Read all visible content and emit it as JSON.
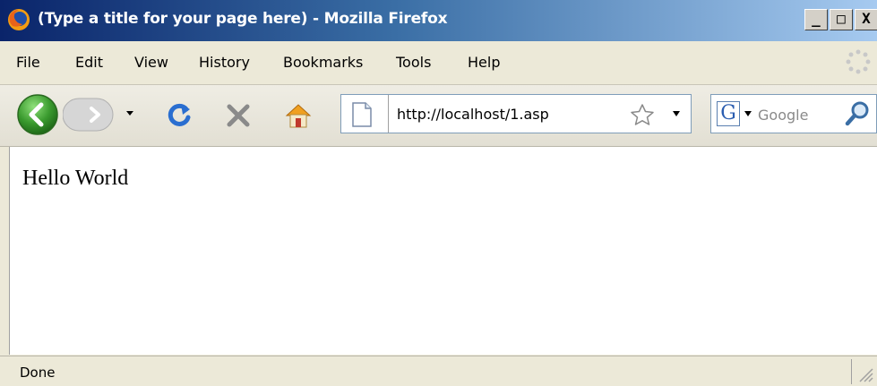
{
  "window": {
    "title": "(Type a title for your page here) - Mozilla Firefox",
    "controls": {
      "minimize": "_",
      "maximize": "□",
      "close": "X"
    }
  },
  "menu": {
    "items": [
      {
        "label": "File"
      },
      {
        "label": "Edit"
      },
      {
        "label": "View"
      },
      {
        "label": "History"
      },
      {
        "label": "Bookmarks"
      },
      {
        "label": "Tools"
      },
      {
        "label": "Help"
      }
    ]
  },
  "toolbar": {
    "icons": [
      "back-arrow-icon",
      "forward-arrow-icon",
      "reload-icon",
      "stop-icon",
      "home-icon"
    ]
  },
  "urlbar": {
    "value": "http://localhost/1.asp"
  },
  "search": {
    "engine_letter": "G",
    "placeholder": "Google"
  },
  "content": {
    "text": "Hello World"
  },
  "status": {
    "text": "Done"
  },
  "colors": {
    "titlebar_start": "#0a246a",
    "titlebar_end": "#a6caf0",
    "chrome": "#ece9d8",
    "back_button": "#3a9a2e",
    "reload": "#2a6ed0",
    "stop": "#8a8a8a"
  }
}
